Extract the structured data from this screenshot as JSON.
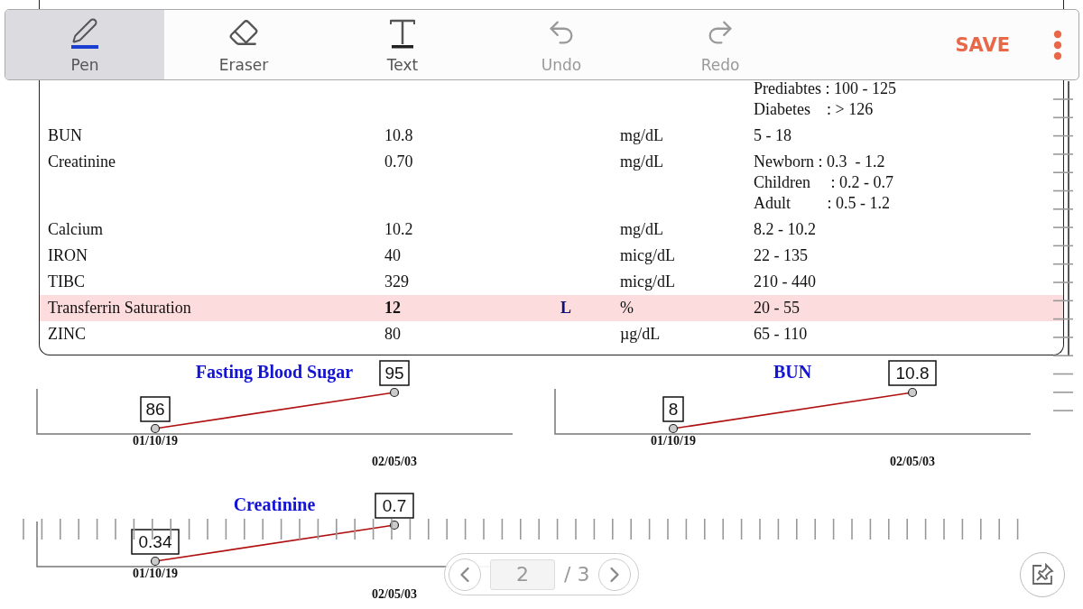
{
  "toolbar": {
    "tools": [
      {
        "kind": "pen",
        "label": "Pen",
        "selected": true
      },
      {
        "kind": "eraser",
        "label": "Eraser",
        "selected": false
      },
      {
        "kind": "text",
        "label": "Text",
        "selected": false
      },
      {
        "kind": "undo",
        "label": "Undo",
        "disabled": true
      },
      {
        "kind": "redo",
        "label": "Redo",
        "disabled": true
      }
    ],
    "save": "SAVE"
  },
  "report": {
    "rows": [
      {
        "reference": [
          "Prediabtes : 100 - 125",
          "Diabetes    : > 126"
        ],
        "flagged": false
      },
      {
        "test": "BUN",
        "result": "10.8",
        "unit": "mg/dL",
        "reference": [
          "5 - 18"
        ],
        "flagged": false
      },
      {
        "test": "Creatinine",
        "result": "0.70",
        "unit": "mg/dL",
        "reference": [
          "Newborn : 0.3  - 1.2",
          "Children     : 0.2 - 0.7",
          "Adult         : 0.5 - 1.2"
        ],
        "flagged": false
      },
      {
        "test": "Calcium",
        "result": "10.2",
        "unit": "mg/dL",
        "reference": [
          "8.2 - 10.2"
        ],
        "flagged": false
      },
      {
        "test": "IRON",
        "result": "40",
        "unit": "micg/dL",
        "reference": [
          "22 - 135"
        ],
        "flagged": false
      },
      {
        "test": "TIBC",
        "result": "329",
        "unit": "micg/dL",
        "reference": [
          "210 - 440"
        ],
        "flagged": false
      },
      {
        "test": "Transferrin Saturation",
        "result": "12",
        "risk": "L",
        "unit": "%",
        "reference": [
          "20 - 55"
        ],
        "flagged": true
      },
      {
        "test": "ZINC",
        "result": "80",
        "unit": "µg/dL",
        "reference": [
          "65 - 110"
        ],
        "flagged": false
      }
    ]
  },
  "charts": [
    {
      "chart_data": {
        "type": "line",
        "title": "Fasting Blood Sugar",
        "categories": [
          "01/10/19",
          "02/05/03"
        ],
        "series": [
          {
            "color": "#b01010",
            "marker": "circle",
            "values": [
              86,
              95
            ]
          }
        ],
        "data_labels": true
      }
    },
    {
      "chart_data": {
        "type": "line",
        "title": "BUN",
        "categories": [
          "01/10/19",
          "02/05/03"
        ],
        "series": [
          {
            "color": "#b01010",
            "marker": "circle",
            "values": [
              8,
              10.8
            ]
          }
        ],
        "data_labels": true
      }
    },
    {
      "chart_data": {
        "type": "line",
        "title": "Creatinine",
        "categories": [
          "01/10/19",
          "02/05/03"
        ],
        "series": [
          {
            "color": "#b01010",
            "marker": "circle",
            "values": [
              0.34,
              0.7
            ]
          }
        ],
        "data_labels": true
      }
    }
  ],
  "pagination": {
    "current": "2",
    "total": "/ 3"
  }
}
